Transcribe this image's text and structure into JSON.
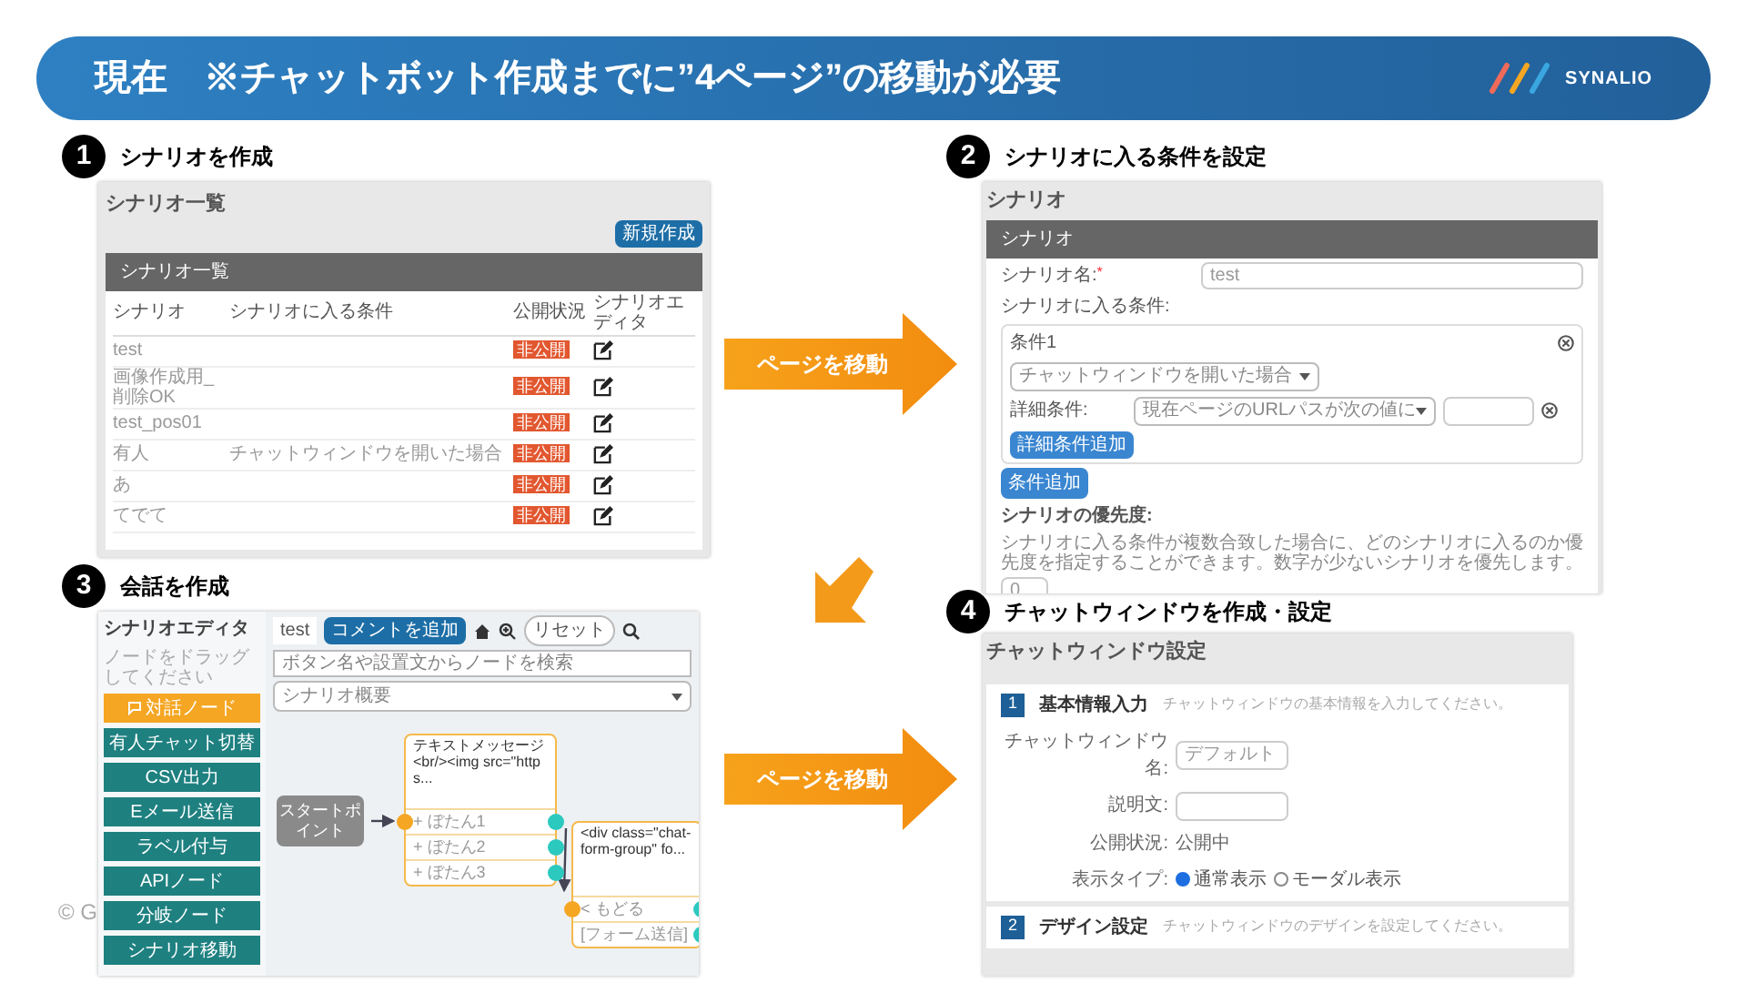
{
  "header": {
    "title": "現在　※チャットボット作成までに”4ページ”の移動が必要",
    "logo_text": "SYNALIO"
  },
  "steps": [
    {
      "kind": "scenario_list",
      "number": "1",
      "title": "シナリオを作成",
      "screen": {
        "heading": "シナリオ一覧",
        "new_button": "新規作成",
        "card_title": "シナリオ一覧",
        "columns": [
          "シナリオ",
          "シナリオに入る条件",
          "公開状況",
          "シナリオエディタ"
        ],
        "rows": [
          {
            "name": "test",
            "status": "非公開"
          },
          {
            "name": "画像作成用_削除OK",
            "status": "非公開"
          },
          {
            "name": "test_pos01",
            "status": "非公開"
          },
          {
            "name": "有人",
            "condition": "チャットウィンドウを開いた場合",
            "status": "非公開"
          },
          {
            "name": "あ",
            "status": "非公開"
          },
          {
            "name": "てでて",
            "status": "非公開"
          }
        ]
      }
    },
    {
      "kind": "scenario_form",
      "number": "2",
      "title": "シナリオに入る条件を設定",
      "screen": {
        "heading": "シナリオ",
        "card_title": "シナリオ",
        "name_label": "シナリオ名:",
        "required_mark": "*",
        "name_value": "test",
        "conditions_label": "シナリオに入る条件:",
        "condition": {
          "title": "条件1",
          "trigger": "チャットウィンドウを開いた場合",
          "detail_label": "詳細条件:",
          "detail_select": "現在ページのURLパスが次の値に",
          "add_detail_button": "詳細条件追加"
        },
        "add_condition_button": "条件追加",
        "priority_label": "シナリオの優先度:",
        "priority_help": "シナリオに入る条件が複数合致した場合に、どのシナリオに入るのか優先度を指定することができます。数字が少ないシナリオを優先します。",
        "priority_value": "0"
      }
    },
    {
      "kind": "scenario_editor",
      "number": "3",
      "title": "会話を作成",
      "screen": {
        "sidebar_title": "シナリオエディタ",
        "hint": "ノードをドラッグしてください",
        "dialog_node_button": "対話ノード",
        "node_buttons": [
          "有人チャット切替",
          "CSV出力",
          "Eメール送信",
          "ラベル付与",
          "APIノード",
          "分岐ノード",
          "シナリオ移動"
        ],
        "tab": "test",
        "comment_button": "コメントを追加",
        "search_placeholder": "ボタン名や設置文からノードを検索",
        "reset_button": "リセット",
        "scenario_select": "シナリオ概要",
        "start_node": "スタートポイント",
        "message_node": {
          "text": "テキストメッセージ<br/><img src=\"https...",
          "options": [
            "+ ぼたん1",
            "+ ぼたん2",
            "+ ぼたん3"
          ]
        },
        "form_node": {
          "text": "<div class=\"chat-form-group\" fo...",
          "options": [
            "< もどる",
            "[フォーム送信]"
          ]
        }
      }
    },
    {
      "kind": "chat_window_settings",
      "number": "4",
      "title": "チャットウィンドウを作成・設定",
      "screen": {
        "heading": "チャットウィンドウ設定",
        "sections": [
          {
            "number": "1",
            "title": "基本情報入力",
            "hint": "チャットウィンドウの基本情報を入力してください。",
            "fields": [
              {
                "kind": "input",
                "label": "チャットウィンドウ名:",
                "value": "デフォルト"
              },
              {
                "kind": "input",
                "label": "説明文:"
              },
              {
                "kind": "text",
                "label": "公開状況:",
                "value": "公開中"
              },
              {
                "kind": "radio",
                "label": "表示タイプ:",
                "options": [
                  {
                    "label": "通常表示",
                    "selected": true
                  },
                  {
                    "label": "モーダル表示",
                    "selected": false
                  }
                ]
              }
            ]
          },
          {
            "number": "2",
            "title": "デザイン設定",
            "hint": "チャットウィンドウのデザインを設定してください。"
          }
        ]
      }
    }
  ],
  "arrows": [
    {
      "label": "ページを移動"
    },
    {
      "label": "ページを移動"
    }
  ],
  "copyright": "© G"
}
